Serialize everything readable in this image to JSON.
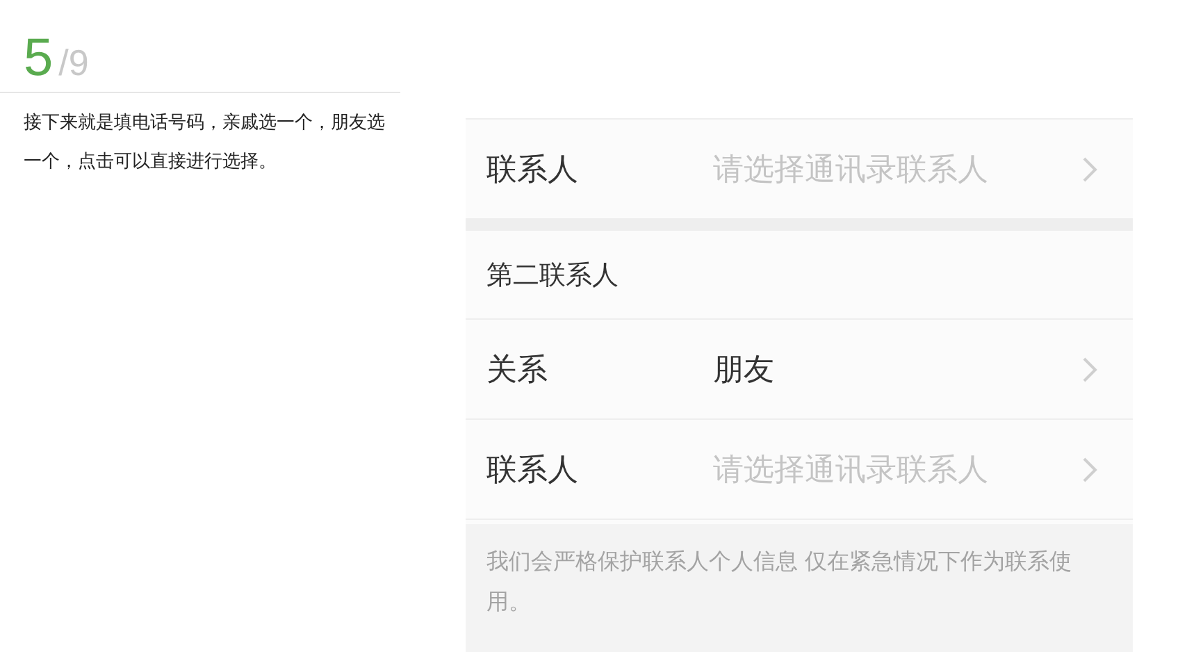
{
  "step": {
    "current": "5",
    "total": "/9"
  },
  "caption": "接下来就是填电话号码，亲戚选一个，朋友选一个，点击可以直接进行选择。",
  "form": {
    "first_group": [
      {
        "label": "联系人",
        "placeholder": "请选择通讯录联系人"
      }
    ],
    "section_title": "第二联系人",
    "second_group": [
      {
        "label": "关系",
        "value": "朋友"
      },
      {
        "label": "联系人",
        "placeholder": "请选择通讯录联系人"
      }
    ],
    "notice": "我们会严格保护联系人个人信息 仅在紧急情况下作为联系使用。"
  }
}
